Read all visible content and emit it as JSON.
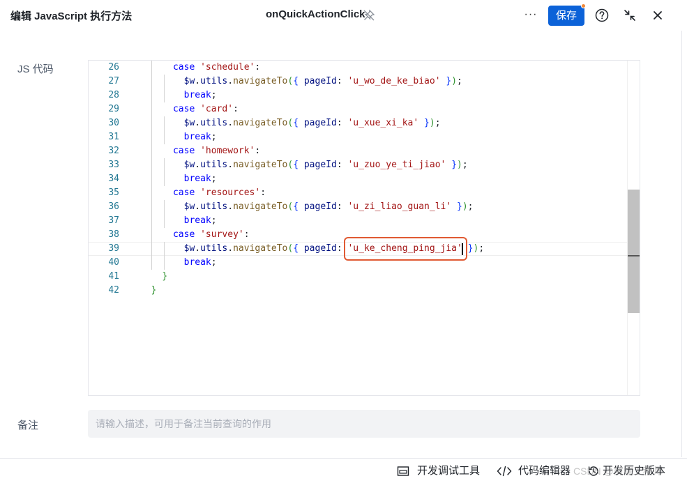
{
  "header": {
    "title": "编辑 JavaScript 执行方法",
    "method_name": "onQuickActionClick",
    "save_label": "保存"
  },
  "form": {
    "code_label": "JS 代码",
    "note_label": "备注",
    "note_placeholder": "请输入描述，可用于备注当前查询的作用",
    "note_value": ""
  },
  "editor": {
    "active_line": 39,
    "line_numbers": [
      "26",
      "27",
      "28",
      "29",
      "30",
      "31",
      "32",
      "33",
      "34",
      "35",
      "36",
      "37",
      "38",
      "39",
      "40",
      "41",
      "42"
    ],
    "lines": [
      {
        "indent": "      ",
        "keyword": "case",
        "string": "'schedule'",
        "rest": ":"
      },
      {
        "indent": "        ",
        "call": "$w.utils.navigateTo({ pageId: ",
        "string": "'u_wo_de_ke_biao'",
        "rest": " });"
      },
      {
        "indent": "        ",
        "keyword": "break",
        "rest": ";"
      },
      {
        "indent": "      ",
        "keyword": "case",
        "string": "'card'",
        "rest": ":"
      },
      {
        "indent": "        ",
        "call": "$w.utils.navigateTo({ pageId: ",
        "string": "'u_xue_xi_ka'",
        "rest": " });"
      },
      {
        "indent": "        ",
        "keyword": "break",
        "rest": ";"
      },
      {
        "indent": "      ",
        "keyword": "case",
        "string": "'homework'",
        "rest": ":"
      },
      {
        "indent": "        ",
        "call": "$w.utils.navigateTo({ pageId: ",
        "string": "'u_zuo_ye_ti_jiao'",
        "rest": " });"
      },
      {
        "indent": "        ",
        "keyword": "break",
        "rest": ";"
      },
      {
        "indent": "      ",
        "keyword": "case",
        "string": "'resources'",
        "rest": ":"
      },
      {
        "indent": "        ",
        "call": "$w.utils.navigateTo({ pageId: ",
        "string": "'u_zi_liao_guan_li'",
        "rest": " });"
      },
      {
        "indent": "        ",
        "keyword": "break",
        "rest": ";"
      },
      {
        "indent": "      ",
        "keyword": "case",
        "string": "'survey'",
        "rest": ":"
      },
      {
        "indent": "        ",
        "call": "$w.utils.navigateTo({ pageId: ",
        "string": "'u_ke_cheng_ping_jia'",
        "rest": " });"
      },
      {
        "indent": "        ",
        "keyword": "break",
        "rest": ";"
      },
      {
        "indent": "    ",
        "brace": "}"
      },
      {
        "indent": "  ",
        "brace": "}"
      }
    ]
  },
  "footer": {
    "debug_tools": "开发调试工具",
    "code_editor": "代码编辑器",
    "history": "开发历史版本"
  },
  "watermark": "CSDN @前端工程师",
  "colors": {
    "accent": "#0c62d8",
    "highlight_border": "#e05a33",
    "save_dot": "#f0883a"
  },
  "icons": [
    "pin-icon",
    "more-icon",
    "help-icon",
    "collapse-icon",
    "close-icon",
    "debug-panel-icon",
    "code-icon",
    "history-icon"
  ]
}
